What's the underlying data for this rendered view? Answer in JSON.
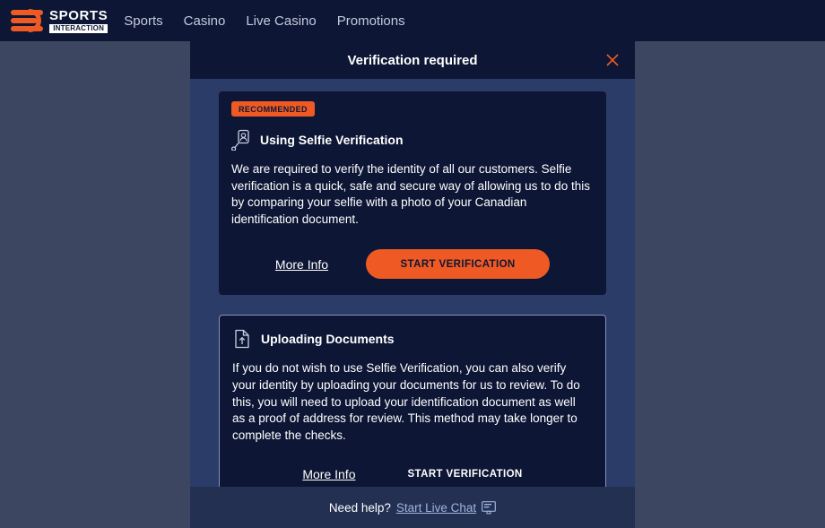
{
  "colors": {
    "page_bg": "#3d4660",
    "nav_bg": "#0d1635",
    "modal_bg": "#2c3c68",
    "card_bg": "#0d1635",
    "accent_orange": "#ef5a24",
    "footer_bg": "#233052",
    "link_blue": "#9fb3e0",
    "card_border": "#8794b8"
  },
  "topnav": {
    "logo": {
      "line1": "SPORTS",
      "line2": "INTERACTION",
      "mark_icon": "sports-interaction-logo-icon"
    },
    "links": [
      {
        "label": "Sports"
      },
      {
        "label": "Casino"
      },
      {
        "label": "Live Casino"
      },
      {
        "label": "Promotions"
      }
    ]
  },
  "modal": {
    "title": "Verification required",
    "close_icon": "close-icon",
    "cards": [
      {
        "badge": "RECOMMENDED",
        "icon": "selfie-verification-icon",
        "title": "Using Selfie Verification",
        "body": "We are required to verify the identity of all our customers. Selfie verification is a quick, safe and secure way of allowing us to do this by comparing your selfie with a photo of your Canadian identification document.",
        "more_info_label": "More Info",
        "action_label": "START VERIFICATION"
      },
      {
        "icon": "upload-document-icon",
        "title": "Uploading Documents",
        "body": "If you do not wish to use Selfie Verification, you can also verify your identity by uploading your documents for us to review. To do this, you will need to upload your identification document as well as a proof of address for review. This method may take longer to complete the checks.",
        "more_info_label": "More Info",
        "action_label": "START VERIFICATION"
      }
    ],
    "footer": {
      "text": "Need help?",
      "link_label": "Start Live Chat",
      "chat_icon": "live-chat-icon"
    }
  }
}
